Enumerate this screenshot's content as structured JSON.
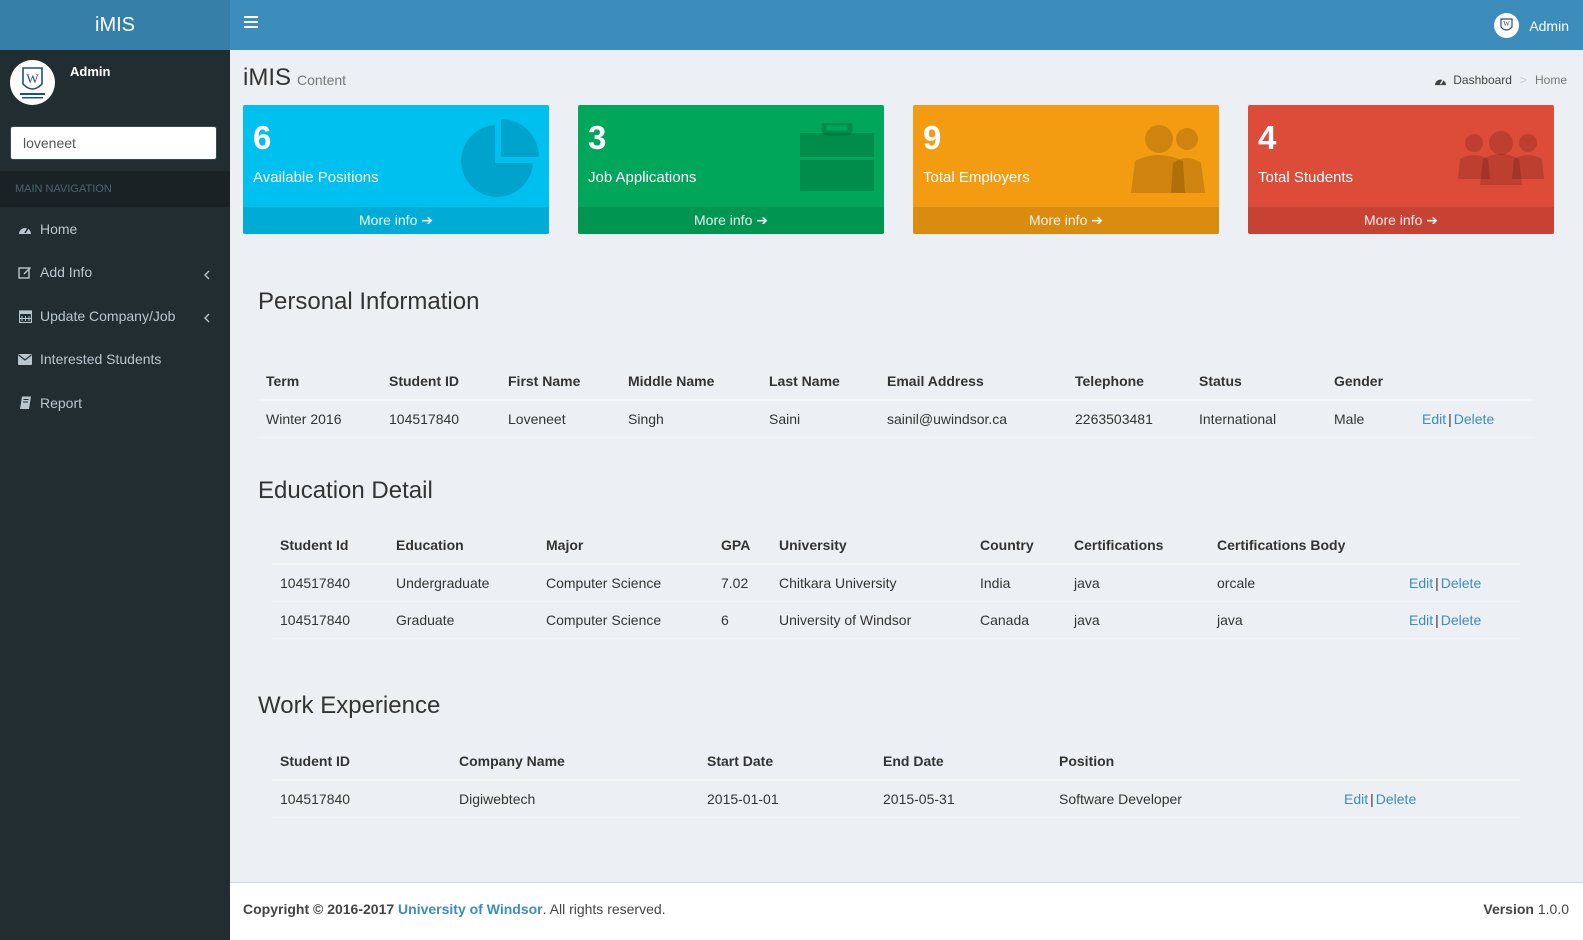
{
  "app": {
    "logo": "iMIS",
    "user": "Admin"
  },
  "sidebar": {
    "user_name": "Admin",
    "search_value": "loveneet",
    "nav_header": "MAIN NAVIGATION",
    "items": [
      {
        "label": "Home",
        "icon": "dashboard-icon"
      },
      {
        "label": "Add Info",
        "icon": "edit-icon"
      },
      {
        "label": "Update Company/Job",
        "icon": "calendar-icon"
      },
      {
        "label": "Interested Students",
        "icon": "envelope-icon"
      },
      {
        "label": "Report",
        "icon": "book-icon"
      }
    ]
  },
  "content": {
    "title": "iMIS",
    "subtitle": "Content",
    "breadcrumb": {
      "first": "Dashboard",
      "current": "Home"
    }
  },
  "boxes": [
    {
      "number": "6",
      "label": "Available Positions",
      "more": "More info",
      "color": "#00c0ef",
      "icon": "pie-chart-icon"
    },
    {
      "number": "3",
      "label": "Job Applications",
      "more": "More info",
      "color": "#00a65a",
      "icon": "briefcase-icon"
    },
    {
      "number": "9",
      "label": "Total Employers",
      "more": "More info",
      "color": "#f39c12",
      "icon": "users-icon"
    },
    {
      "number": "4",
      "label": "Total Students",
      "more": "More info",
      "color": "#dd4b39",
      "icon": "group-icon"
    }
  ],
  "personal": {
    "title": "Personal Information",
    "headers": [
      "Term",
      "Student ID",
      "First Name",
      "Middle Name",
      "Last Name",
      "Email Address",
      "Telephone",
      "Status",
      "Gender"
    ],
    "rows": [
      [
        "Winter 2016",
        "104517840",
        "Loveneet",
        "Singh",
        "Saini",
        "sainil@uwindsor.ca",
        "2263503481",
        "International",
        "Male"
      ]
    ]
  },
  "education": {
    "title": "Education Detail",
    "headers": [
      "Student Id",
      "Education",
      "Major",
      "GPA",
      "University",
      "Country",
      "Certifications",
      "Certifications Body"
    ],
    "rows": [
      [
        "104517840",
        "Undergraduate",
        "Computer Science",
        "7.02",
        "Chitkara University",
        "India",
        "java",
        "orcale"
      ],
      [
        "104517840",
        "Graduate",
        "Computer Science",
        "6",
        "University of Windsor",
        "Canada",
        "java",
        "java"
      ]
    ]
  },
  "work": {
    "title": "Work Experience",
    "headers": [
      "Student ID",
      "Company Name",
      "Start Date",
      "End Date",
      "Position"
    ],
    "rows": [
      [
        "104517840",
        "Digiwebtech",
        "2015-01-01",
        "2015-05-31",
        "Software Developer"
      ]
    ]
  },
  "actions": {
    "edit": "Edit",
    "sep": "|",
    "delete": "Delete"
  },
  "footer": {
    "copyright": "Copyright © 2016-2017",
    "org": "University of Windsor",
    "rights": ". All rights reserved.",
    "version_label": "Version",
    "version": "1.0.0"
  }
}
